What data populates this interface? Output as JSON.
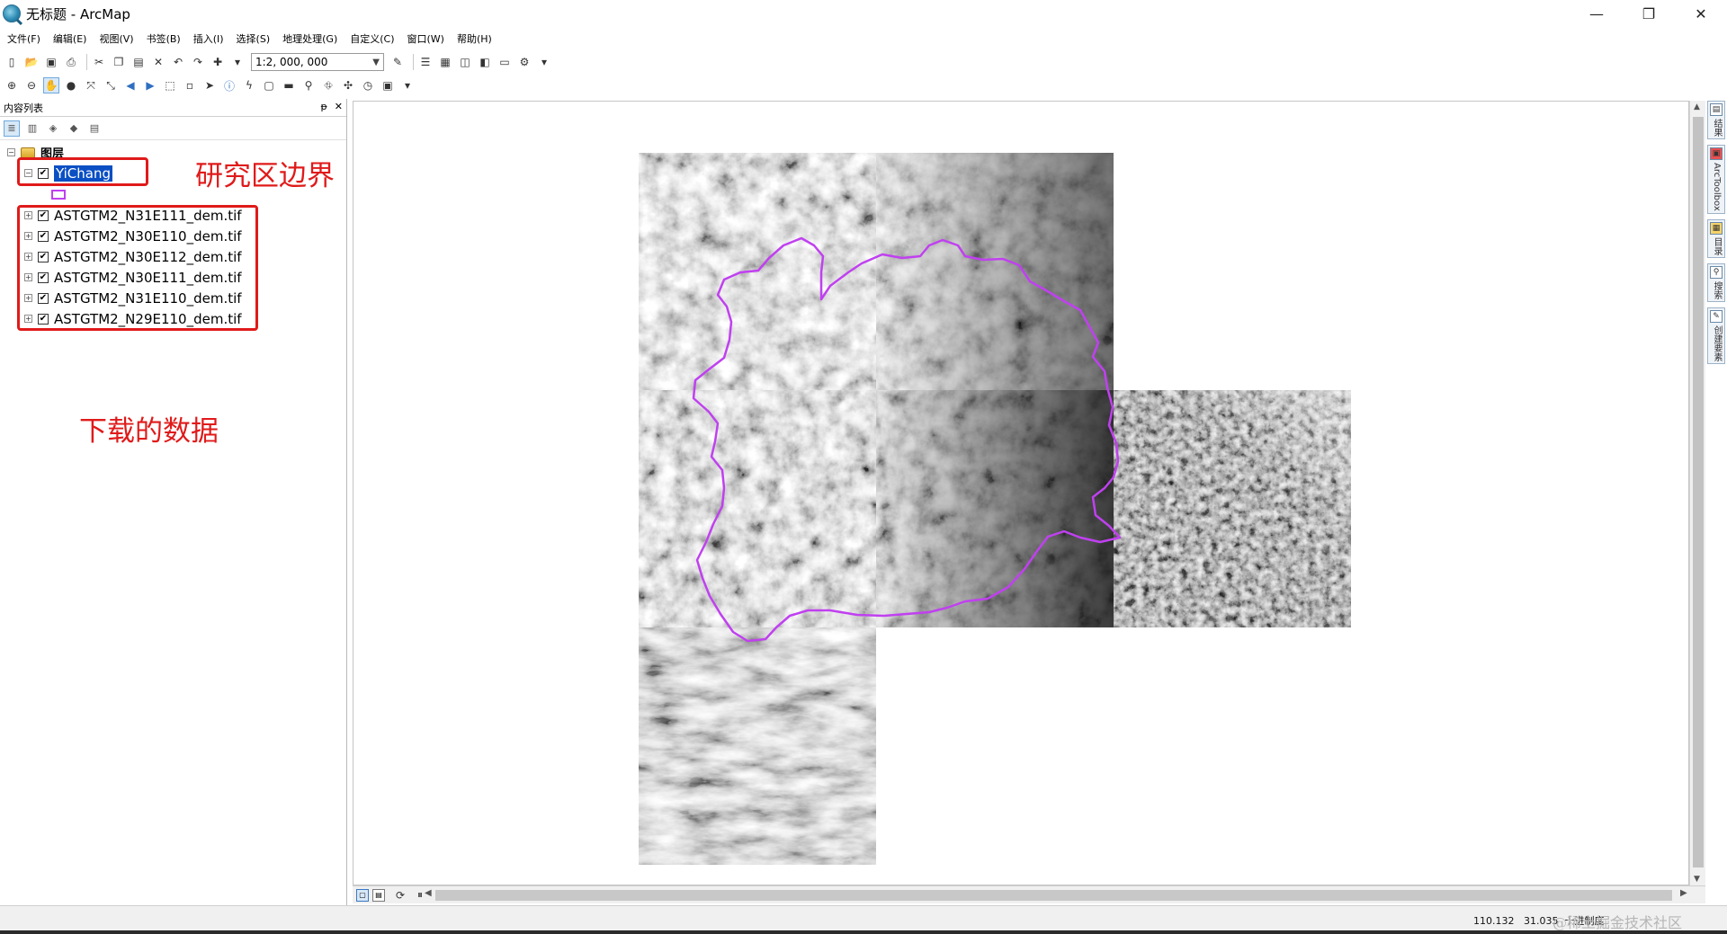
{
  "window": {
    "title": "无标题 - ArcMap",
    "minimize": "—",
    "restore": "❐",
    "close": "✕"
  },
  "menu": [
    "文件(F)",
    "编辑(E)",
    "视图(V)",
    "书签(B)",
    "插入(I)",
    "选择(S)",
    "地理处理(G)",
    "自定义(C)",
    "窗口(W)",
    "帮助(H)"
  ],
  "toolbar": {
    "scale": "1:2, 000, 000"
  },
  "toc": {
    "title": "内容列表",
    "pin": "ᵽ",
    "close": "✕",
    "group_label": "图层",
    "boundary_layer": "YiChang",
    "dem_layers": [
      "ASTGTM2_N31E111_dem.tif",
      "ASTGTM2_N30E110_dem.tif",
      "ASTGTM2_N30E112_dem.tif",
      "ASTGTM2_N30E111_dem.tif",
      "ASTGTM2_N31E110_dem.tif",
      "ASTGTM2_N29E110_dem.tif"
    ]
  },
  "annotations": {
    "boundary": "研究区边界",
    "data": "下载的数据"
  },
  "right_dock": [
    {
      "icon": "results-icon",
      "label": "结果"
    },
    {
      "icon": "arctoolbox-icon",
      "label": "ArcToolbox"
    },
    {
      "icon": "catalog-icon",
      "label": "目录"
    },
    {
      "icon": "search-icon",
      "label": "搜索"
    },
    {
      "icon": "create-features-icon",
      "label": "创建要素"
    }
  ],
  "status": {
    "x": "110.132",
    "y": "31.035",
    "units": "十进制度",
    "watermark": "@稀土掘金技术社区"
  },
  "colors": {
    "annotation_red": "#e01a1a",
    "boundary_purple": "#c040f0",
    "selection_blue": "#0a4fc4"
  }
}
